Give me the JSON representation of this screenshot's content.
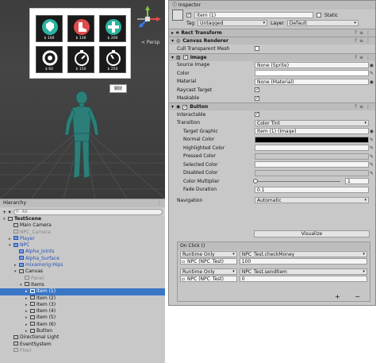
{
  "scene": {
    "persp_label": "< Persp",
    "close_button": "關閉",
    "shop_items": [
      {
        "price": "$ 100",
        "icon": "shield-heart-icon",
        "color": "#2ab3a0"
      },
      {
        "price": "$ 130",
        "icon": "boot-icon",
        "color": "#e14b4b"
      },
      {
        "price": "$ 200",
        "icon": "plus-icon",
        "color": "#2ab3a0"
      },
      {
        "price": "$ 60",
        "icon": "refresh-icon",
        "color": "#ffffff"
      },
      {
        "price": "$ 150",
        "icon": "stopwatch-icon",
        "color": "#ffffff"
      },
      {
        "price": "$ 250",
        "icon": "stopwatch-icon",
        "color": "#ffffff"
      }
    ]
  },
  "hierarchy": {
    "tab_label": "Hierarchy",
    "add_label": "+ ▾",
    "search_placeholder": "All",
    "rows": [
      {
        "label": "TestScene",
        "depth": 0,
        "style": "bold",
        "arrow": "▾"
      },
      {
        "label": "Main Camera",
        "depth": 1,
        "style": "",
        "arrow": ""
      },
      {
        "label": "NPC_Camera",
        "depth": 1,
        "style": "dis",
        "arrow": ""
      },
      {
        "label": "Player",
        "depth": 1,
        "style": "pre",
        "arrow": "▸"
      },
      {
        "label": "NPC",
        "depth": 1,
        "style": "pre",
        "arrow": "▾"
      },
      {
        "label": "Alpha_Joints",
        "depth": 2,
        "style": "pre",
        "arrow": ""
      },
      {
        "label": "Alpha_Surface",
        "depth": 2,
        "style": "pre",
        "arrow": ""
      },
      {
        "label": "mixamorig:Hips",
        "depth": 2,
        "style": "pre",
        "arrow": "▸"
      },
      {
        "label": "Canvas",
        "depth": 2,
        "style": "",
        "arrow": "▾"
      },
      {
        "label": "Panel",
        "depth": 3,
        "style": "dis",
        "arrow": ""
      },
      {
        "label": "Items",
        "depth": 3,
        "style": "",
        "arrow": "▾"
      },
      {
        "label": "Item (1)",
        "depth": 4,
        "style": "sel",
        "arrow": "▸"
      },
      {
        "label": "Item (2)",
        "depth": 4,
        "style": "",
        "arrow": "▸"
      },
      {
        "label": "Item (3)",
        "depth": 4,
        "style": "",
        "arrow": "▸"
      },
      {
        "label": "Item (4)",
        "depth": 4,
        "style": "",
        "arrow": "▸"
      },
      {
        "label": "Item (5)",
        "depth": 4,
        "style": "",
        "arrow": "▸"
      },
      {
        "label": "Item (6)",
        "depth": 4,
        "style": "",
        "arrow": "▸"
      },
      {
        "label": "Button",
        "depth": 4,
        "style": "",
        "arrow": "▸"
      },
      {
        "label": "Directional Light",
        "depth": 1,
        "style": "",
        "arrow": ""
      },
      {
        "label": "EventSystem",
        "depth": 1,
        "style": "",
        "arrow": ""
      },
      {
        "label": "Floor",
        "depth": 1,
        "style": "dis",
        "arrow": ""
      }
    ]
  },
  "inspector": {
    "tab_label": "Inspector",
    "object_name": "Item (1)",
    "static_label": "Static",
    "tag_label": "Tag",
    "tag_value": "Untagged",
    "layer_label": "Layer",
    "layer_value": "Default",
    "rect_transform": "Rect Transform",
    "canvas_renderer": "Canvas Renderer",
    "cull_label": "Cull Transparent Mesh",
    "image": {
      "title": "Image",
      "source_label": "Source Image",
      "source_value": "None (Sprite)",
      "color_label": "Color",
      "material_label": "Material",
      "material_value": "None (Material)",
      "raycast_label": "Raycast Target",
      "maskable_label": "Maskable"
    },
    "button": {
      "title": "Button",
      "interactable_label": "Interactable",
      "transition_label": "Transition",
      "transition_value": "Color Tint",
      "target_label": "Target Graphic",
      "target_value": "Item (1) (Image)",
      "normal_label": "Normal Color",
      "highlighted_label": "Highlighted Color",
      "pressed_label": "Pressed Color",
      "selected_label": "Selected Color",
      "disabled_label": "Disabled Color",
      "multiplier_label": "Color Multiplier",
      "multiplier_value": "1",
      "fade_label": "Fade Duration",
      "fade_value": "0.1",
      "navigation_label": "Navigation",
      "navigation_value": "Automatic",
      "visualize_label": "Visualize",
      "normal_color": "#000000",
      "highlighted_color": "#f5f5f5",
      "pressed_color": "#c8c8c8",
      "selected_color": "#f5f5f5",
      "disabled_color": "#c8c8c8"
    },
    "onclick": {
      "title": "On Click ()",
      "events": [
        {
          "mode": "Runtime Only",
          "func": "NPC_Test.checkMoney",
          "target": "NPC (NPC_Test)",
          "arg": "100"
        },
        {
          "mode": "Runtime Only",
          "func": "NPC_Test.sendItem",
          "target": "NPC (NPC_Test)",
          "arg": "0"
        }
      ],
      "footer": "+ −"
    }
  }
}
